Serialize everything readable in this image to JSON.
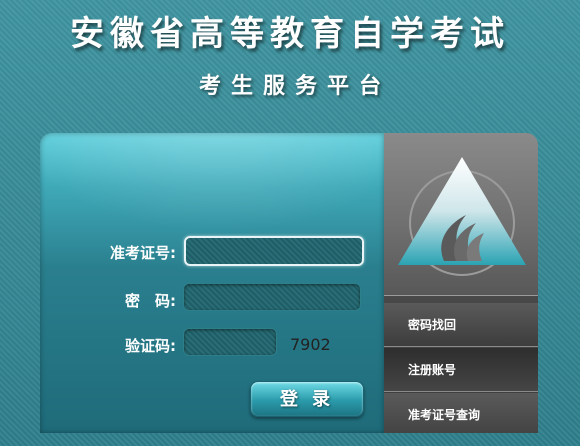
{
  "header": {
    "title": "安徽省高等教育自学考试",
    "subtitle": "考生服务平台"
  },
  "login": {
    "id_label": "准考证号:",
    "password_label": "密　码:",
    "captcha_label": "验证码:",
    "captcha_code": "7902",
    "id_value": "",
    "password_value": "",
    "captcha_value": "",
    "login_button": "登录"
  },
  "sidebar": {
    "logo_icon": "triangle-flame-logo-icon",
    "items": [
      {
        "label": "密码找回"
      },
      {
        "label": "注册账号"
      },
      {
        "label": "准考证号查询"
      }
    ]
  },
  "colors": {
    "background": "#3a8b97",
    "panel_top": "#5fd0dd",
    "panel_bottom": "#1f6b7a",
    "sidebar": "#4a4a4a"
  }
}
